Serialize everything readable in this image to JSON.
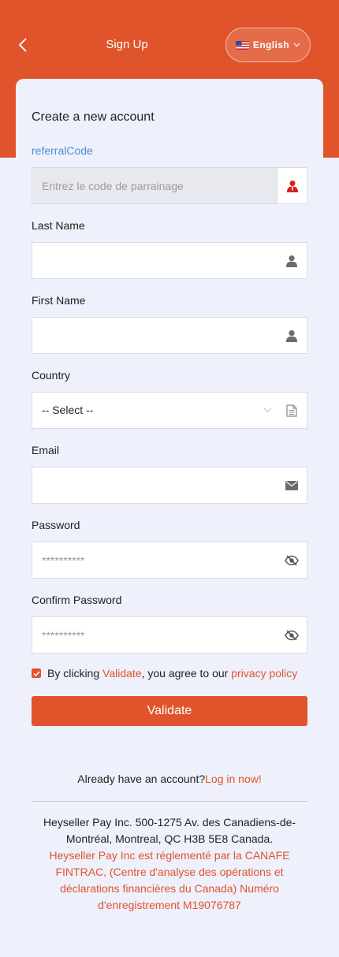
{
  "header": {
    "title": "Sign Up",
    "language": "English",
    "accent_color": "#e0542c"
  },
  "form": {
    "title": "Create a new account",
    "referral": {
      "label": "referralCode",
      "placeholder": "Entrez le code de parrainage",
      "icon": "user-referral-icon"
    },
    "last_name": {
      "label": "Last Name",
      "value": "",
      "icon": "user-icon"
    },
    "first_name": {
      "label": "First Name",
      "value": "",
      "icon": "user-icon"
    },
    "country": {
      "label": "Country",
      "selected": "-- Select --",
      "icon": "document-icon"
    },
    "email": {
      "label": "Email",
      "value": "",
      "icon": "envelope-icon"
    },
    "password": {
      "label": "Password",
      "placeholder": "**********",
      "icon": "eye-slash-icon"
    },
    "confirm_password": {
      "label": "Confirm Password",
      "placeholder": "**********",
      "icon": "eye-slash-icon"
    },
    "agree": {
      "checked": true,
      "prefix": "By clicking ",
      "validate_link": "Validate",
      "middle": ", you agree to our ",
      "policy_link": "privacy policy"
    },
    "submit_label": "Validate"
  },
  "login": {
    "text": "Already have an account?",
    "link": "Log in now!"
  },
  "footer": {
    "address": "Heyseller Pay Inc. 500-1275 Av. des Canadiens-de-Montréal, Montreal, QC H3B 5E8 Canada.",
    "regulation": "Heyseller Pay Inc est réglementé par la CANAFE FINTRAC, (Centre d'analyse des opérations et déclarations financières du Canada) Numéro d'enregistrement M19076787"
  }
}
